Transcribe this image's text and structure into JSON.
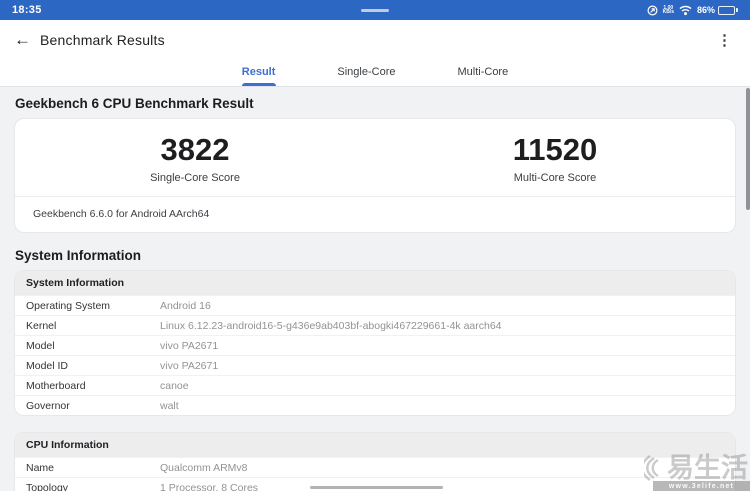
{
  "status_bar": {
    "time": "18:35",
    "network_speed_value": "1.00",
    "network_speed_unit": "KB/s",
    "battery_percent": "86%",
    "background_color": "#2c67c3"
  },
  "header": {
    "title": "Benchmark Results",
    "back_glyph": "←",
    "menu_glyph": "⋮"
  },
  "tabs": [
    {
      "label": "Result",
      "active": true
    },
    {
      "label": "Single-Core",
      "active": false
    },
    {
      "label": "Multi-Core",
      "active": false
    }
  ],
  "result": {
    "section_title": "Geekbench 6 CPU Benchmark Result",
    "scores": [
      {
        "value": "3822",
        "label": "Single-Core Score"
      },
      {
        "value": "11520",
        "label": "Multi-Core Score"
      }
    ],
    "footnote": "Geekbench 6.6.0 for Android AArch64",
    "accent_color": "#3e6fd0"
  },
  "system_information": {
    "section_title": "System Information",
    "tables": [
      {
        "header": "System Information",
        "rows": [
          {
            "label": "Operating System",
            "value": "Android 16"
          },
          {
            "label": "Kernel",
            "value": "Linux 6.12.23-android16-5-g436e9ab403bf-abogki467229661-4k aarch64"
          },
          {
            "label": "Model",
            "value": "vivo PA2671"
          },
          {
            "label": "Model ID",
            "value": "vivo PA2671"
          },
          {
            "label": "Motherboard",
            "value": "canoe"
          },
          {
            "label": "Governor",
            "value": "walt"
          }
        ]
      },
      {
        "header": "CPU Information",
        "rows": [
          {
            "label": "Name",
            "value": "Qualcomm ARMv8"
          },
          {
            "label": "Topology",
            "value": "1 Processor, 8 Cores"
          }
        ]
      }
    ]
  },
  "watermark": {
    "text": "易生活",
    "url": "www.3elife.net"
  }
}
